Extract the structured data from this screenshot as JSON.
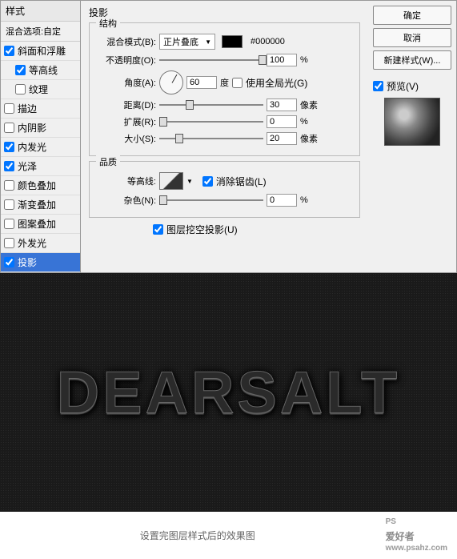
{
  "sidebar": {
    "title": "样式",
    "blend_options": "混合选项:自定",
    "items": [
      {
        "label": "斜面和浮雕",
        "checked": true
      },
      {
        "label": "等高线",
        "checked": true,
        "indent": true
      },
      {
        "label": "纹理",
        "checked": false,
        "indent": true
      },
      {
        "label": "描边",
        "checked": false
      },
      {
        "label": "内阴影",
        "checked": false
      },
      {
        "label": "内发光",
        "checked": true
      },
      {
        "label": "光泽",
        "checked": true
      },
      {
        "label": "颜色叠加",
        "checked": false
      },
      {
        "label": "渐变叠加",
        "checked": false
      },
      {
        "label": "图案叠加",
        "checked": false
      },
      {
        "label": "外发光",
        "checked": false
      },
      {
        "label": "投影",
        "checked": true,
        "selected": true
      }
    ]
  },
  "panel": {
    "title": "投影",
    "structure_label": "结构",
    "blend_mode_label": "混合模式(B):",
    "blend_mode_value": "正片叠底",
    "color_hex": "#000000",
    "opacity_label": "不透明度(O):",
    "opacity_value": "100",
    "angle_label": "角度(A):",
    "angle_value": "60",
    "angle_unit": "度",
    "global_light": "使用全局光(G)",
    "distance_label": "距离(D):",
    "distance_value": "30",
    "distance_unit": "像素",
    "spread_label": "扩展(R):",
    "spread_value": "0",
    "size_label": "大小(S):",
    "size_value": "20",
    "size_unit": "像素",
    "quality_label": "品质",
    "contour_label": "等高线:",
    "antialias": "消除锯齿(L)",
    "noise_label": "杂色(N):",
    "noise_value": "0",
    "knockout": "图层挖空投影(U)",
    "percent": "%"
  },
  "buttons": {
    "ok": "确定",
    "cancel": "取消",
    "new_style": "新建样式(W)...",
    "preview": "预览(V)"
  },
  "result_text": "DEARSALT",
  "caption": "设置完图层样式后的效果图",
  "watermark": {
    "main": "PS",
    "sub": "爱好者",
    "url": "www.psahz.com"
  }
}
